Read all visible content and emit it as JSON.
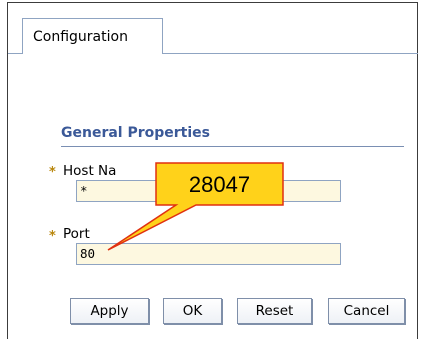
{
  "tabs": [
    {
      "label": "Configuration",
      "active": true
    }
  ],
  "section": {
    "title": "General Properties"
  },
  "fields": [
    {
      "label": "Host Na",
      "value": "*",
      "required": true
    },
    {
      "label": "Port",
      "value": "80",
      "required": true
    }
  ],
  "required_marker": "*",
  "buttons": {
    "apply": "Apply",
    "ok": "OK",
    "reset": "Reset",
    "cancel": "Cancel"
  },
  "callout": {
    "text": "28047"
  },
  "colors": {
    "section_title": "#3b5998",
    "input_bg": "#fdf8e0",
    "callout_fill": "#ffd21a",
    "callout_border": "#e03010",
    "required_marker": "#b8860b"
  }
}
